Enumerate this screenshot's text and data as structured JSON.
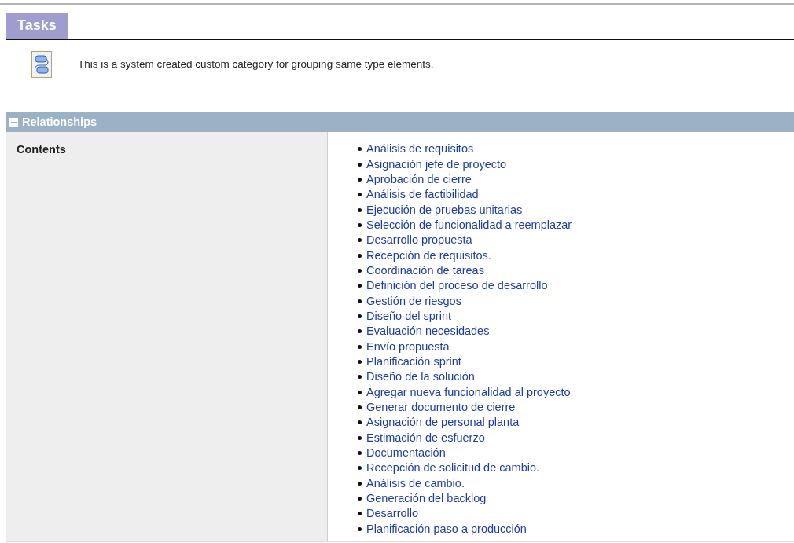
{
  "page_title": "Tasks",
  "description": "This is a system created custom category for grouping same type elements.",
  "section": {
    "title": "Relationships",
    "expanded": true,
    "rows": [
      {
        "label": "Contents",
        "items": [
          "Análisis de requisitos",
          "Asignación jefe de proyecto",
          "Aprobación de cierre",
          "Análisis de factibilidad",
          "Ejecución de pruebas unitarias",
          "Selección de funcionalidad a reemplazar",
          "Desarrollo propuesta",
          "Recepción de requisitos.",
          "Coordinación de tareas",
          "Definición del proceso de desarrollo",
          "Gestión de riesgos",
          "Diseño del sprint",
          "Evaluación necesidades",
          "Envío propuesta",
          "Planificación sprint",
          "Diseño de la solución",
          "Agregar nueva funcionalidad al proyecto",
          "Generar documento de cierre",
          "Asignación de personal planta",
          "Estimación de esfuerzo",
          "Documentación",
          "Recepción de solicitud de cambio.",
          "Análisis de cambio.",
          "Generación del backlog",
          "Desarrollo",
          "Planificación paso a producción"
        ]
      }
    ]
  }
}
